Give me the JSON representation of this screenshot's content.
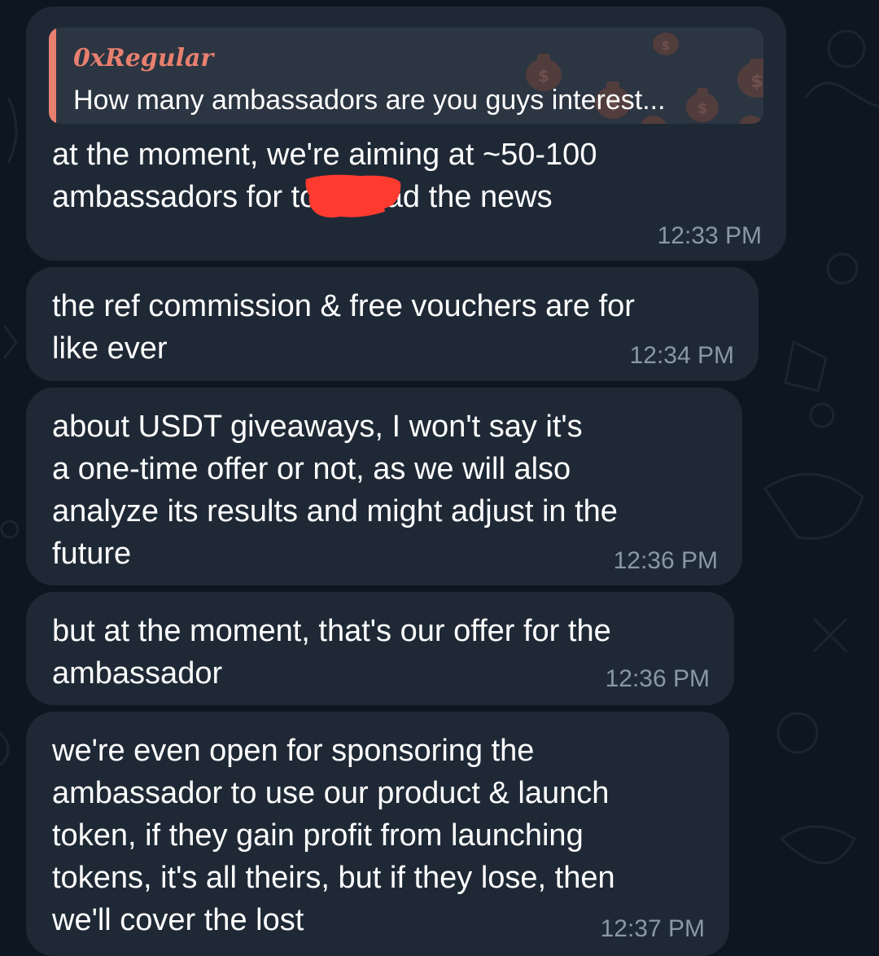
{
  "messages": [
    {
      "reply": {
        "author": "0xRegular",
        "text": "How many ambassadors are you guys interest..."
      },
      "text": "at the moment, we're aiming at ~50-100\nambassadors for        to spread the news",
      "time": "12:33 PM"
    },
    {
      "text": "the ref commission & free vouchers are for\nlike ever",
      "time": "12:34 PM"
    },
    {
      "text": "about USDT giveaways, I won't say it's\na one-time offer or not, as we will also\nanalyze its results and might adjust in the\nfuture",
      "time": "12:36 PM"
    },
    {
      "text": "but at the moment, that's our offer for the\nambassador",
      "time": "12:36 PM"
    },
    {
      "text": "we're even open for sponsoring the\nambassador to use our product & launch\ntoken, if they gain profit from launching\ntokens, it's all theirs, but if they lose, then\nwe'll cover the lost",
      "time": "12:37 PM"
    }
  ],
  "colors": {
    "background": "#0e1621",
    "bubble": "#1f2936",
    "reply_background": "#2c3542",
    "reply_accent": "#e8806f",
    "timestamp": "#8b97a5",
    "redaction": "#ff3b30"
  }
}
